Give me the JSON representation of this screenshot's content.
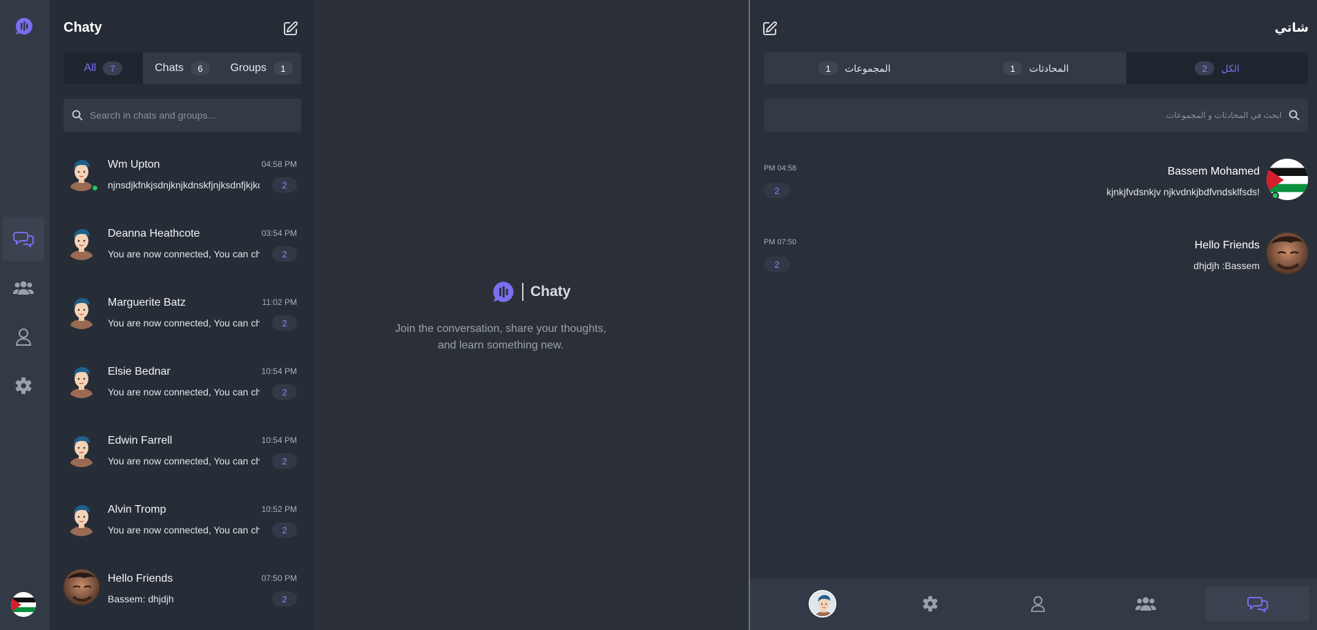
{
  "left_app": {
    "title": "Chaty",
    "tabs": [
      {
        "label": "All",
        "count": "7"
      },
      {
        "label": "Chats",
        "count": "6"
      },
      {
        "label": "Groups",
        "count": "1"
      }
    ],
    "search_placeholder": "Search in chats and groups...",
    "chats": [
      {
        "name": "Wm Upton",
        "time": "04:58 PM",
        "message": "njnsdjkfnkjsdnjknjkdnskfjnjksdnfjkjkdnfjksdn",
        "unread": "2",
        "online": true,
        "avatar": "cartoon"
      },
      {
        "name": "Deanna Heathcote",
        "time": "03:54 PM",
        "message": "You are now connected, You can chat now",
        "unread": "2",
        "online": false,
        "avatar": "cartoon"
      },
      {
        "name": "Marguerite Batz",
        "time": "11:02 PM",
        "message": "You are now connected, You can chat now",
        "unread": "2",
        "online": false,
        "avatar": "cartoon"
      },
      {
        "name": "Elsie Bednar",
        "time": "10:54 PM",
        "message": "You are now connected, You can chat now",
        "unread": "2",
        "online": false,
        "avatar": "cartoon"
      },
      {
        "name": "Edwin Farrell",
        "time": "10:54 PM",
        "message": "You are now connected, You can chat now",
        "unread": "2",
        "online": false,
        "avatar": "cartoon"
      },
      {
        "name": "Alvin Tromp",
        "time": "10:52 PM",
        "message": "You are now connected, You can chat now",
        "unread": "2",
        "online": false,
        "avatar": "cartoon"
      },
      {
        "name": "Hello Friends",
        "time": "07:50 PM",
        "message": "Bassem: dhjdjh",
        "unread": "2",
        "online": false,
        "avatar": "photo"
      }
    ],
    "brand_name": "Chaty",
    "tagline_line1": "Join the conversation, share your thoughts,",
    "tagline_line2": "and learn something new."
  },
  "right_app": {
    "title": "شاتي",
    "tabs": [
      {
        "label": "الكل",
        "count": "2"
      },
      {
        "label": "المحادثات",
        "count": "1"
      },
      {
        "label": "المجموعات",
        "count": "1"
      }
    ],
    "search_placeholder": "ابحث في المحادثات و المجموعات.",
    "chats": [
      {
        "name": "Bassem Mohamed",
        "time": "PM 04:58",
        "message": "!kjnkjfvdsnkjv njkvdnkjbdfvndsklfsds",
        "unread": "2",
        "online": true,
        "avatar": "flag"
      },
      {
        "name": "Hello Friends",
        "time": "PM 07:50",
        "message": "dhjdjh :Bassem",
        "unread": "2",
        "online": false,
        "avatar": "photo"
      }
    ],
    "bottom_nav": [
      "avatar",
      "gear-icon",
      "user-icon",
      "users-icon",
      "chat-icon"
    ]
  },
  "colors": {
    "accent": "#7c6ef0",
    "online": "#22c55e",
    "rail": "#323a45",
    "panel": "#262d37",
    "background": "#2b3038"
  }
}
